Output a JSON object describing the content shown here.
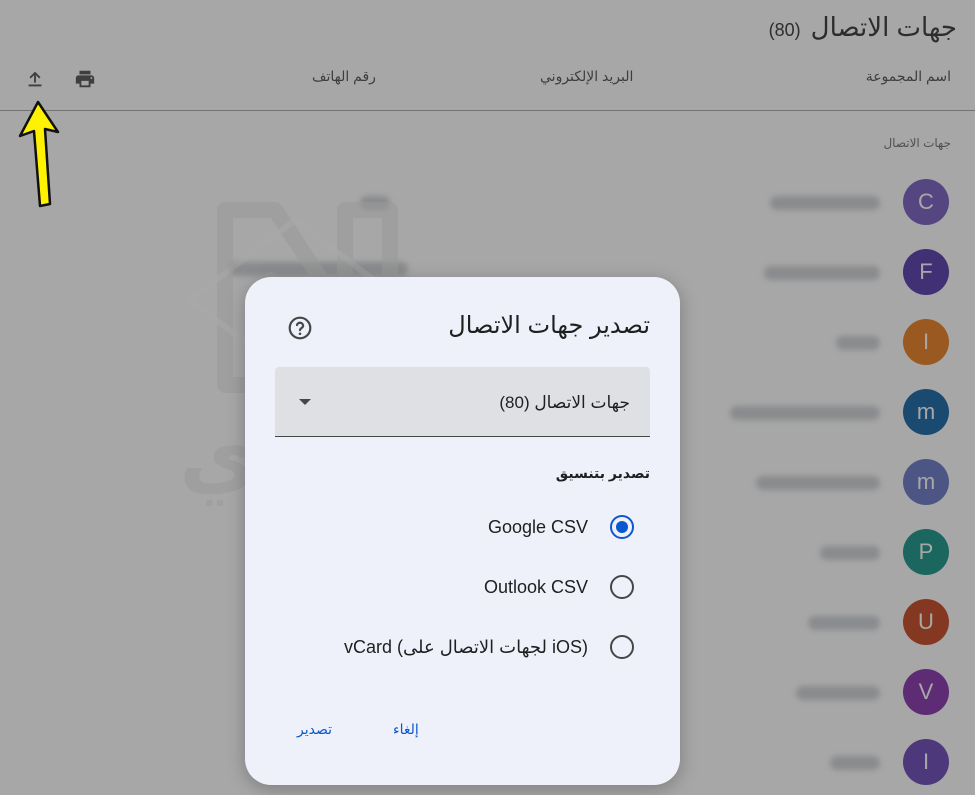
{
  "header": {
    "title": "جهات الاتصال",
    "count": "(80)"
  },
  "toolbar": {
    "export_icon": "upload-icon",
    "print_icon": "printer-icon"
  },
  "columns": {
    "group_name": "اسم المجموعة",
    "email": "البريد الإلكتروني",
    "phone": "رقم الهاتف"
  },
  "section_label": "جهات الاتصال",
  "contacts": [
    {
      "initial": "C",
      "color": "#6b4fbb"
    },
    {
      "initial": "F",
      "color": "#4527a0"
    },
    {
      "initial": "I",
      "color": "#e8710a"
    },
    {
      "initial": "m",
      "color": "#01579b"
    },
    {
      "initial": "m",
      "color": "#5c6bc0"
    },
    {
      "initial": "P",
      "color": "#00897b"
    },
    {
      "initial": "U",
      "color": "#bf360c"
    },
    {
      "initial": "V",
      "color": "#7b1fa2"
    },
    {
      "initial": "I",
      "color": "#5e35b1"
    }
  ],
  "dialog": {
    "title": "تصدير جهات الاتصال",
    "help_icon": "help-circle-icon",
    "select_value": "جهات الاتصال (80)",
    "format_label": "تصدير بتنسيق",
    "options": [
      {
        "label": "Google CSV",
        "checked": true
      },
      {
        "label": "Outlook CSV",
        "checked": false
      },
      {
        "label": "vCard (لجهات الاتصال على iOS)",
        "checked": false
      }
    ],
    "cancel_label": "إلغاء",
    "export_label": "تصدير"
  },
  "watermark": {
    "text": "نتاوي"
  },
  "colors": {
    "accent": "#0b57d0",
    "arrow": "#fff200",
    "dialog_bg": "#eef1f9"
  }
}
